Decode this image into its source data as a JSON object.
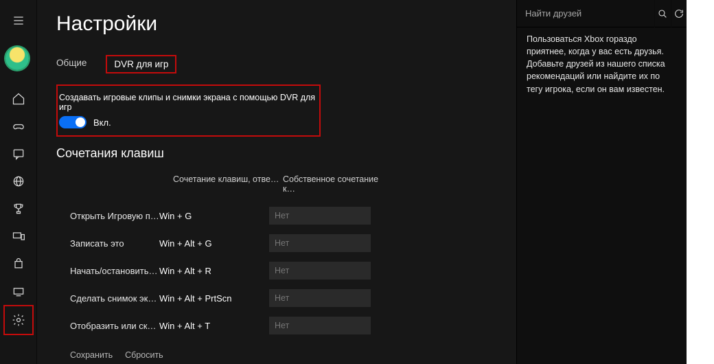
{
  "page_title": "Настройки",
  "tabs": {
    "general": "Общие",
    "dvr": "DVR для игр"
  },
  "dvr_toggle": {
    "caption": "Создавать игровые клипы и снимки экрана с помощью DVR для игр",
    "state_label": "Вкл."
  },
  "shortcuts": {
    "section_title": "Сочетания клавиш",
    "header_fixed": "Сочетание клавиш, отве…",
    "header_custom": "Собственное сочетание к…",
    "rows": [
      {
        "label": "Открыть Игровую пан…",
        "fixed": "Win + G",
        "custom": "Нет"
      },
      {
        "label": "Записать это",
        "fixed": "Win + Alt + G",
        "custom": "Нет"
      },
      {
        "label": "Начать/остановить зап…",
        "fixed": "Win + Alt + R",
        "custom": "Нет"
      },
      {
        "label": "Сделать снимок экрана",
        "fixed": "Win + Alt + PrtScn",
        "custom": "Нет"
      },
      {
        "label": "Отобразить или скрыт…",
        "fixed": "Win + Alt + T",
        "custom": "Нет"
      }
    ]
  },
  "footer": {
    "save": "Сохранить",
    "reset": "Сбросить"
  },
  "right_panel": {
    "search_placeholder": "Найти друзей",
    "body": "Пользоваться Xbox гораздо приятнее, когда у вас есть друзья. Добавьте друзей из нашего списка рекомендаций или найдите их по тегу игрока, если он вам известен."
  }
}
